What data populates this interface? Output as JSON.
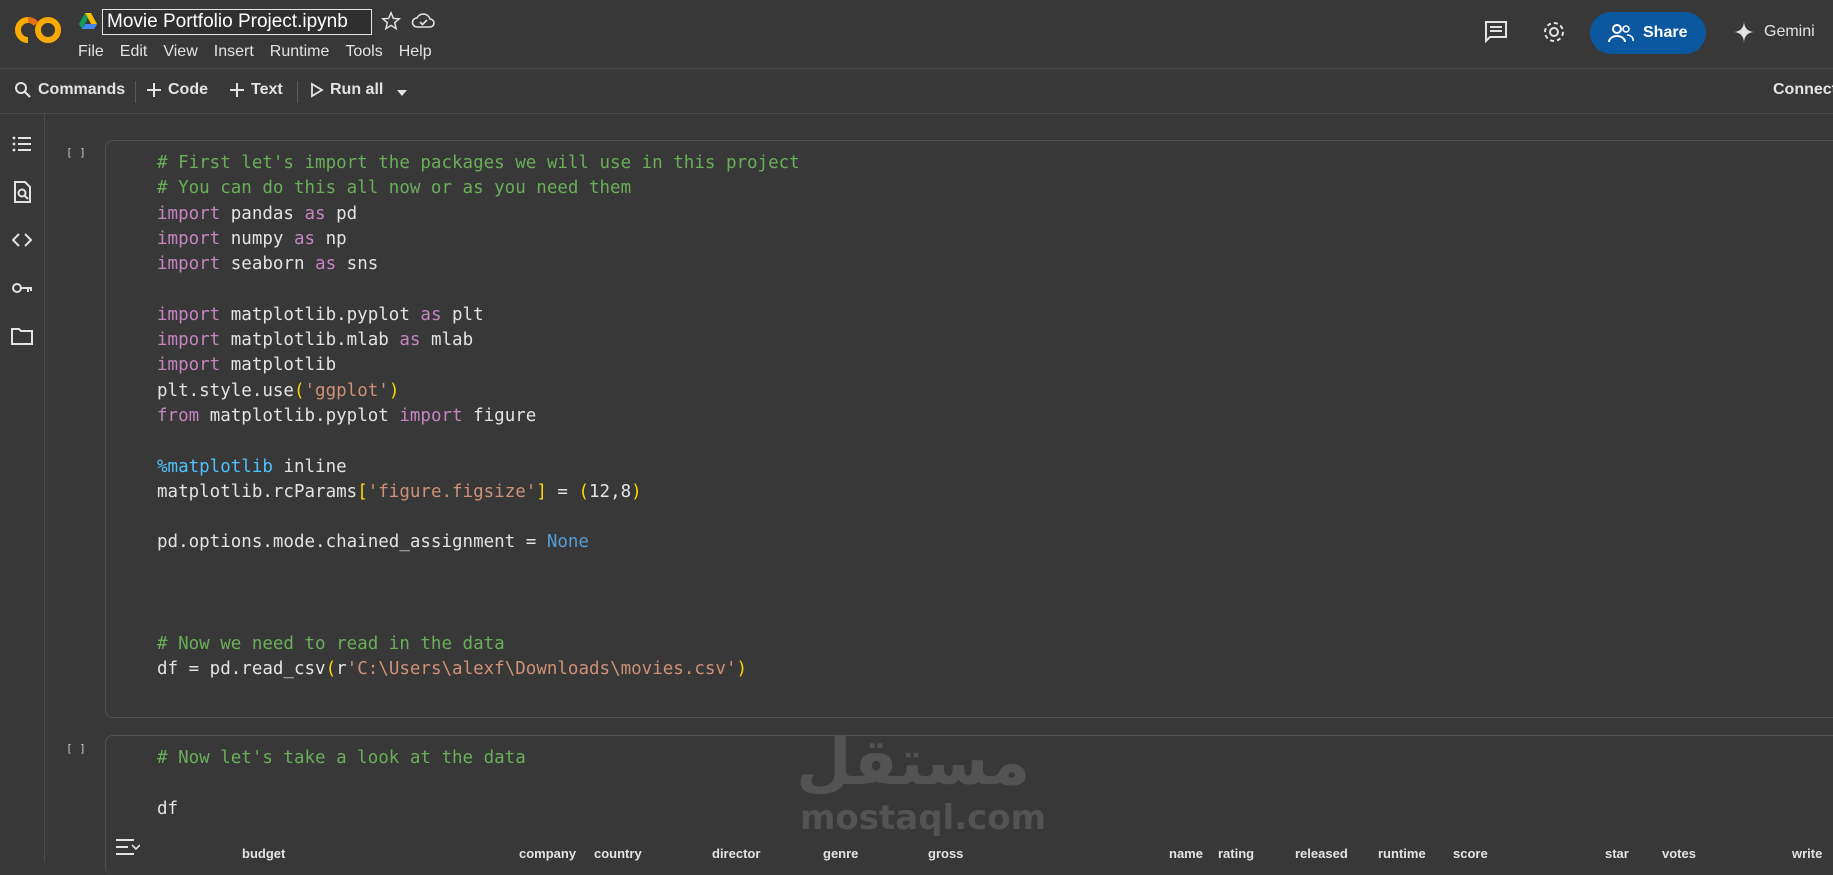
{
  "app": {
    "notebook_title": "Movie Portfolio Project.ipynb",
    "menu": [
      "File",
      "Edit",
      "View",
      "Insert",
      "Runtime",
      "Tools",
      "Help"
    ],
    "share_label": "Share",
    "gemini_label": "Gemini",
    "brand_color": "#f9ab00",
    "share_color": "#0b57a0"
  },
  "toolbar": {
    "commands_label": "Commands",
    "code_label": "Code",
    "text_label": "Text",
    "run_all_label": "Run all",
    "connect_label": "Connect"
  },
  "rail": {
    "icons": [
      "table-of-contents-icon",
      "find-icon",
      "code-snippets-icon",
      "secrets-key-icon",
      "files-folder-icon"
    ]
  },
  "cells": [
    {
      "execution_marker": "[ ]",
      "lines": [
        "# First let's import the packages we will use in this project",
        "# You can do this all now or as you need them",
        "import pandas as pd",
        "import numpy as np",
        "import seaborn as sns",
        "",
        "import matplotlib.pyplot as plt",
        "import matplotlib.mlab as mlab",
        "import matplotlib",
        "plt.style.use('ggplot')",
        "from matplotlib.pyplot import figure",
        "",
        "%matplotlib inline",
        "matplotlib.rcParams['figure.figsize'] = (12,8)",
        "",
        "pd.options.mode.chained_assignment = None",
        "",
        "",
        "",
        "# Now we need to read in the data",
        "df = pd.read_csv(r'C:\\Users\\alexf\\Downloads\\movies.csv')"
      ]
    },
    {
      "execution_marker": "[ ]",
      "lines": [
        "# Now let's take a look at the data",
        "",
        "df"
      ]
    }
  ],
  "output_columns": [
    "budget",
    "company",
    "country",
    "director",
    "genre",
    "gross",
    "name",
    "rating",
    "released",
    "runtime",
    "score",
    "star",
    "votes",
    "write"
  ],
  "watermark": {
    "arabic": "مستقل",
    "latin": "mostaql.com"
  }
}
